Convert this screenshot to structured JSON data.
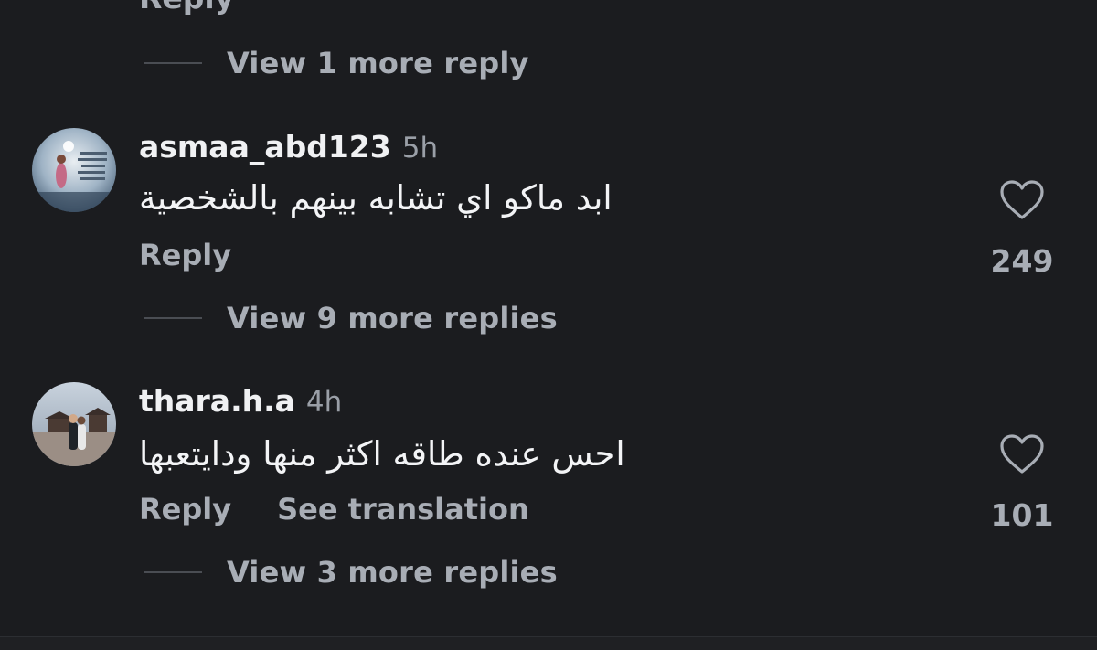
{
  "top": {
    "partial_reply_label": "Reply",
    "view_more_label": "View 1 more reply"
  },
  "comments": [
    {
      "username": "asmaa_abd123",
      "time": "5h",
      "text": "ابد ماكو اي تشابه بينهم بالشخصية",
      "reply_label": "Reply",
      "like_count": "249",
      "view_more_label": "View 9 more replies"
    },
    {
      "username": "thara.h.a",
      "time": "4h",
      "text": "احس عنده طاقه اكثر منها ودايتعبها",
      "reply_label": "Reply",
      "translate_label": "See translation",
      "like_count": "101",
      "view_more_label": "View 3 more replies"
    }
  ],
  "colors": {
    "background": "#1b1c1f",
    "primary_text": "#f0f1f3",
    "secondary_text": "#a8adb5"
  },
  "icons": {
    "like": "heart-outline-icon"
  }
}
